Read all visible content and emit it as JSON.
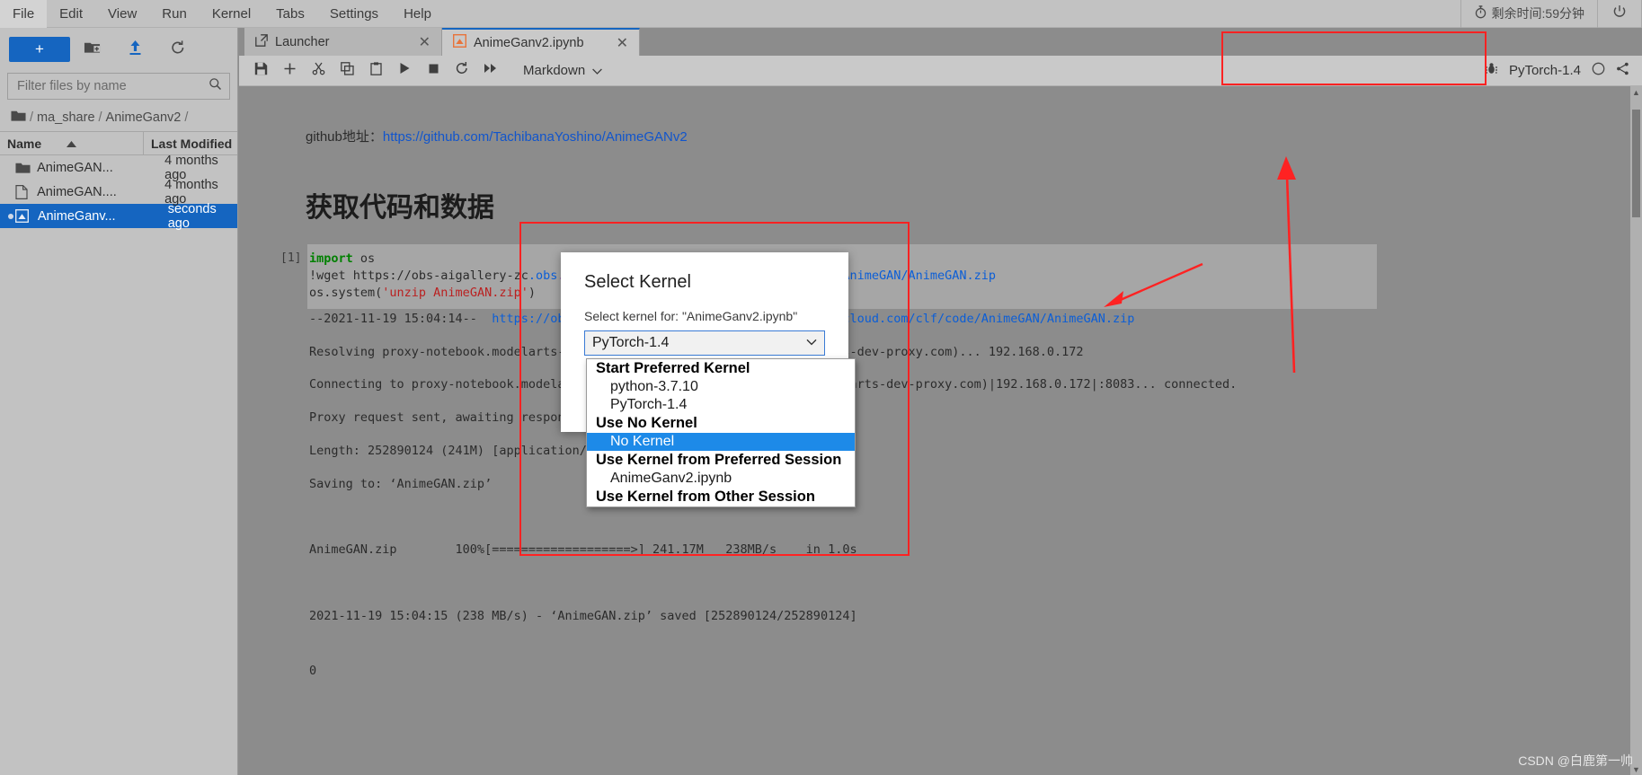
{
  "menubar": {
    "items": [
      "File",
      "Edit",
      "View",
      "Run",
      "Kernel",
      "Tabs",
      "Settings",
      "Help"
    ],
    "timer_text": "剩余时间:59分钟",
    "timer_icon": "stopwatch-icon",
    "power_icon": "power-icon"
  },
  "sidebar": {
    "new_button_label": "+",
    "new_folder_icon": "new-folder-icon",
    "upload_icon": "upload-icon",
    "refresh_icon": "refresh-icon",
    "filter_placeholder": "Filter files by name",
    "filter_value": "",
    "search_icon": "search-icon",
    "breadcrumb": {
      "home_icon": "folder-icon",
      "segments": [
        "/",
        "ma_share",
        "/",
        "AnimeGanv2",
        "/"
      ]
    },
    "columns": [
      "Name",
      "Last Modified"
    ],
    "sort_icon": "sort-ascending-icon",
    "files": [
      {
        "name": "AnimeGAN...",
        "modified": "4 months ago",
        "icon": "folder-icon",
        "selected": false,
        "running": false
      },
      {
        "name": "AnimeGAN....",
        "modified": "4 months ago",
        "icon": "file-icon",
        "selected": false,
        "running": false
      },
      {
        "name": "AnimeGanv...",
        "modified": "seconds ago",
        "icon": "notebook-icon",
        "selected": true,
        "running": true
      }
    ]
  },
  "tabs": [
    {
      "label": "Launcher",
      "icon": "launcher-icon",
      "close_icon": "close-icon",
      "active": false
    },
    {
      "label": "AnimeGanv2.ipynb",
      "icon": "notebook-icon",
      "close_icon": "close-icon",
      "active": true
    }
  ],
  "notebook_toolbar": {
    "buttons": [
      {
        "name": "save-button",
        "icon": "save-icon"
      },
      {
        "name": "insert-cell-button",
        "icon": "plus-icon"
      },
      {
        "name": "cut-cell-button",
        "icon": "scissors-icon"
      },
      {
        "name": "copy-cell-button",
        "icon": "copy-icon"
      },
      {
        "name": "paste-cell-button",
        "icon": "clipboard-icon"
      },
      {
        "name": "run-cell-button",
        "icon": "play-icon"
      },
      {
        "name": "interrupt-kernel-button",
        "icon": "stop-icon"
      },
      {
        "name": "restart-kernel-button",
        "icon": "restart-icon"
      },
      {
        "name": "restart-and-run-all-button",
        "icon": "fast-forward-icon"
      }
    ],
    "cell_type": "Markdown",
    "cell_type_caret": "chevron-down-icon",
    "debug_icon": "bug-icon",
    "kernel_name": "PyTorch-1.4",
    "kernel_status_icon": "circle-idle-icon",
    "share_icon": "share-icon"
  },
  "content": {
    "github_label": "github地址：",
    "github_url": "https://github.com/TachibanaYoshino/AnimeGANv2",
    "heading": "获取代码和数据",
    "cell_prompt": "[1]",
    "code_lines": [
      "import os",
      "!wget https://obs-aigallery-zc.obs.cn-north-4.myhuaweicloud.com/clf/code/AnimeGAN/AnimeGAN.zip",
      "os.system('unzip AnimeGAN.zip')"
    ],
    "output_lines": [
      "--2021-11-19 15:04:14--  https://obs-aigallery-zc.obs.cn-north-4.myhuaweicloud.com/clf/code/AnimeGAN/AnimeGAN.zip",
      "Resolving proxy-notebook.modelarts-dev-proxy.com (proxy-notebook.modelarts-dev-proxy.com)... 192.168.0.172",
      "Connecting to proxy-notebook.modelarts-dev-proxy.com (proxy-notebook.modelarts-dev-proxy.com)|192.168.0.172|:8083... connected.",
      "Proxy request sent, awaiting response... 200 OK",
      "Length: 252890124 (241M) [application/zip]",
      "Saving to: ‘AnimeGAN.zip’",
      "AnimeGAN.zip        100%[===================>] 241.17M   238MB/s    in 1.0s",
      "2021-11-19 15:04:15 (238 MB/s) - ‘AnimeGAN.zip’ saved [252890124/252890124]",
      "0"
    ]
  },
  "modal": {
    "title": "Select Kernel",
    "subtitle": "Select kernel for: \"AnimeGanv2.ipynb\"",
    "selected_value": "PyTorch-1.4",
    "caret_icon": "chevron-down-icon",
    "dropdown": [
      {
        "type": "group",
        "label": "Start Preferred Kernel"
      },
      {
        "type": "item",
        "label": "python-3.7.10",
        "highlight": false
      },
      {
        "type": "item",
        "label": "PyTorch-1.4",
        "highlight": false
      },
      {
        "type": "group",
        "label": "Use No Kernel"
      },
      {
        "type": "item",
        "label": "No Kernel",
        "highlight": true
      },
      {
        "type": "group",
        "label": "Use Kernel from Preferred Session"
      },
      {
        "type": "item",
        "label": "AnimeGanv2.ipynb",
        "highlight": false
      },
      {
        "type": "group",
        "label": "Use Kernel from Other Session"
      }
    ]
  },
  "watermark": "CSDN @白鹿第一帅",
  "colors": {
    "accent": "#1565c0",
    "annotation": "#ff2222",
    "highlight": "#1d8ae8",
    "link": "#1155cc"
  }
}
